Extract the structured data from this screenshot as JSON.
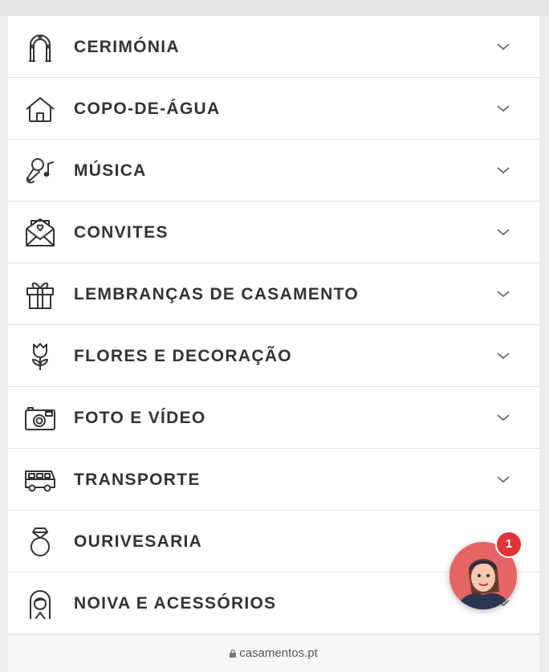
{
  "menu": {
    "items": [
      {
        "label": "CERIMÓNIA",
        "icon": "arch-icon"
      },
      {
        "label": "COPO-DE-ÁGUA",
        "icon": "house-icon"
      },
      {
        "label": "MÚSICA",
        "icon": "microphone-music-icon"
      },
      {
        "label": "CONVITES",
        "icon": "envelope-heart-icon"
      },
      {
        "label": "LEMBRANÇAS DE CASAMENTO",
        "icon": "gift-icon"
      },
      {
        "label": "FLORES E DECORAÇÃO",
        "icon": "tulip-icon"
      },
      {
        "label": "FOTO E VÍDEO",
        "icon": "camera-icon"
      },
      {
        "label": "TRANSPORTE",
        "icon": "bus-icon"
      },
      {
        "label": "OURIVESARIA",
        "icon": "ring-icon"
      },
      {
        "label": "NOIVA E ACESSÓRIOS",
        "icon": "bride-icon"
      }
    ]
  },
  "browser": {
    "domain": "casamentos.pt"
  },
  "chat": {
    "badge_count": "1"
  },
  "colors": {
    "text": "#333333",
    "badge": "#e0343a",
    "chat_bg": "#e56565"
  }
}
